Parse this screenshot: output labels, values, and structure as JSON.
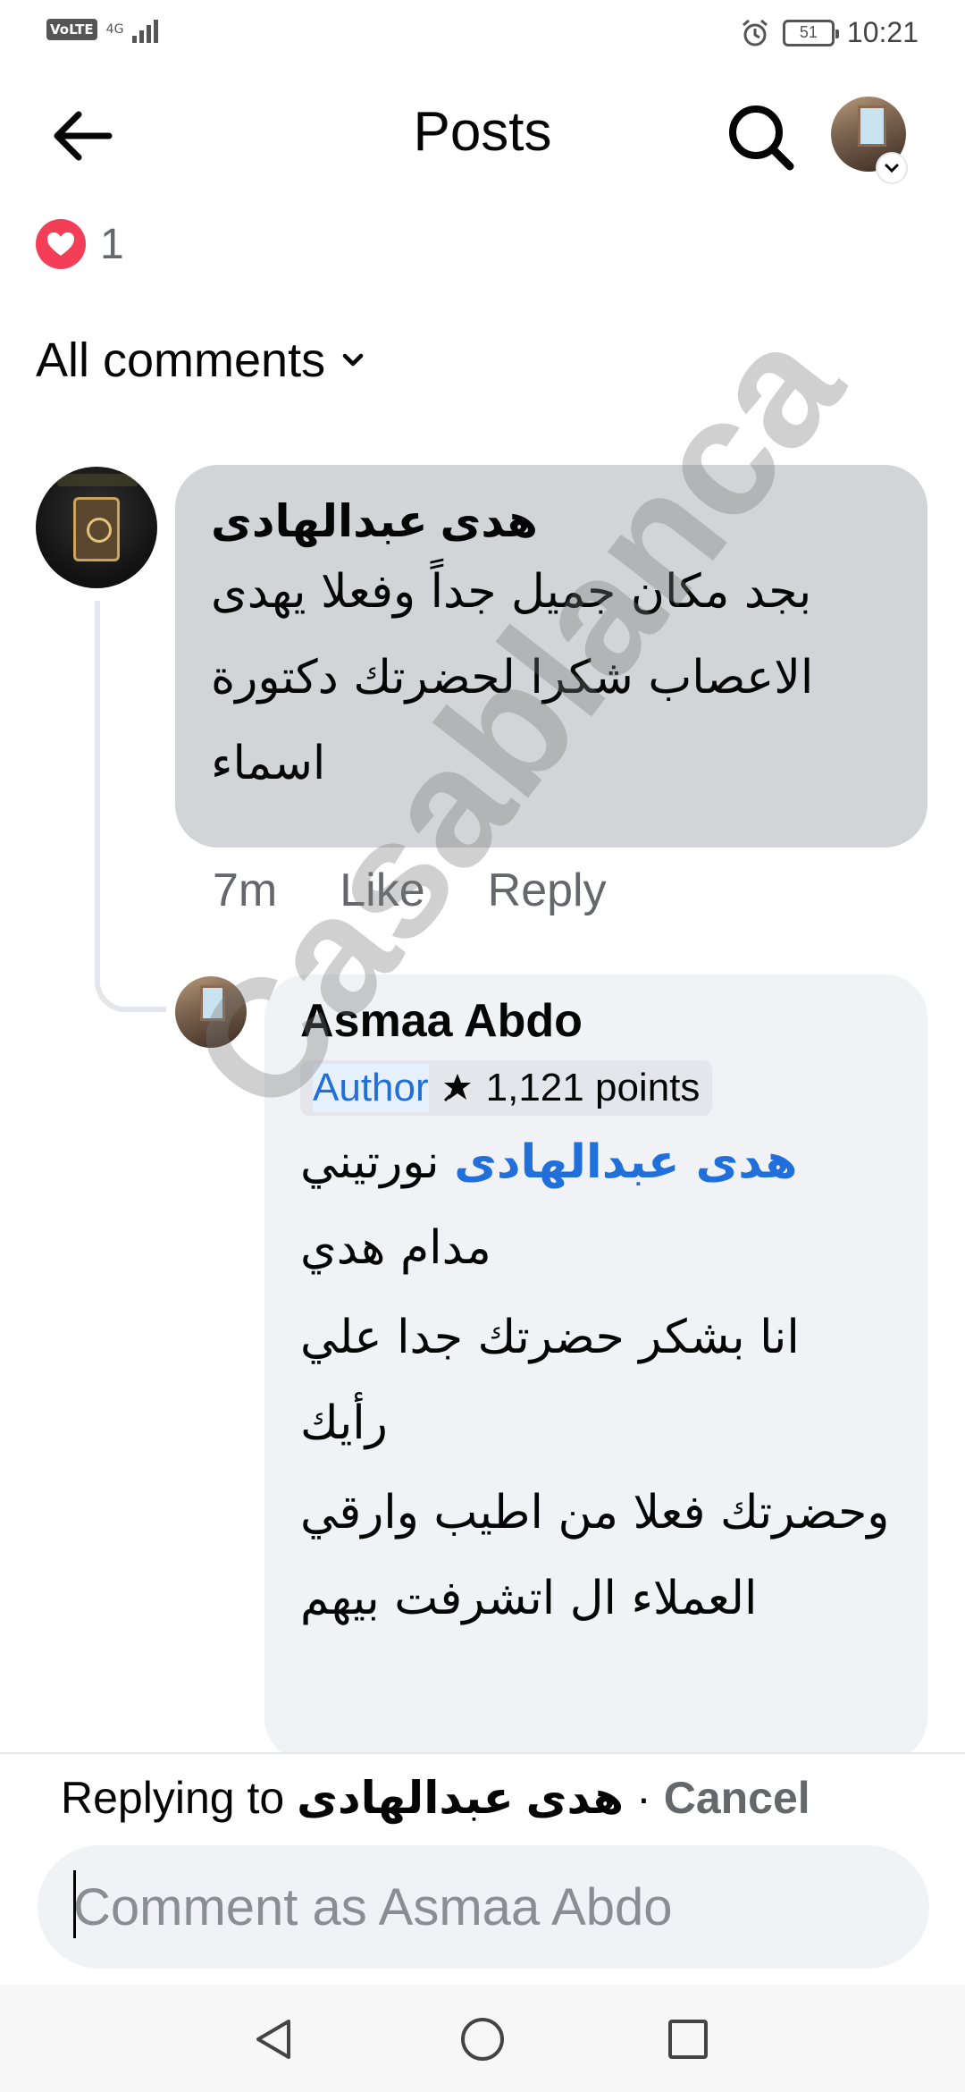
{
  "status_bar": {
    "volte": "VoLTE",
    "network": "4G",
    "battery": "51",
    "time": "10:21"
  },
  "header": {
    "title": "Posts",
    "icons": [
      "back-arrow-icon",
      "search-icon",
      "profile-avatar",
      "chevron-down-icon"
    ]
  },
  "reactions": {
    "icon": "heart-icon",
    "count": "1"
  },
  "filter": {
    "label": "All comments"
  },
  "comments": [
    {
      "author": "هدى عبدالهادى",
      "text": "بجد مكان جميل جداً وفعلا يهدى الاعصاب شكرا لحضرتك دكتورة اسماء",
      "time": "7m",
      "like_label": "Like",
      "reply_label": "Reply"
    }
  ],
  "reply": {
    "author": "Asmaa Abdo",
    "badge": "Author",
    "points": "1,121 points",
    "mention": "هدى عبدالهادى",
    "text_after_mention": " نورتيني مدام هدي",
    "lines": [
      "انا بشكر حضرتك جدا علي رأيك",
      "وحضرتك فعلا من اطيب وارقي العملاء ال اتشرفت بيهم"
    ]
  },
  "reply_bar": {
    "prefix": "Replying to",
    "target": "هدى عبدالهادى",
    "separator": "·",
    "cancel": "Cancel",
    "placeholder": "Comment as Asmaa Abdo"
  },
  "watermark": "Casablanca",
  "colors": {
    "accent": "#216fdb",
    "heart": "#f33e58",
    "bubble_comment": "#d2d4d8",
    "bubble_reply": "#f0f2f5",
    "muted": "#65676b"
  }
}
